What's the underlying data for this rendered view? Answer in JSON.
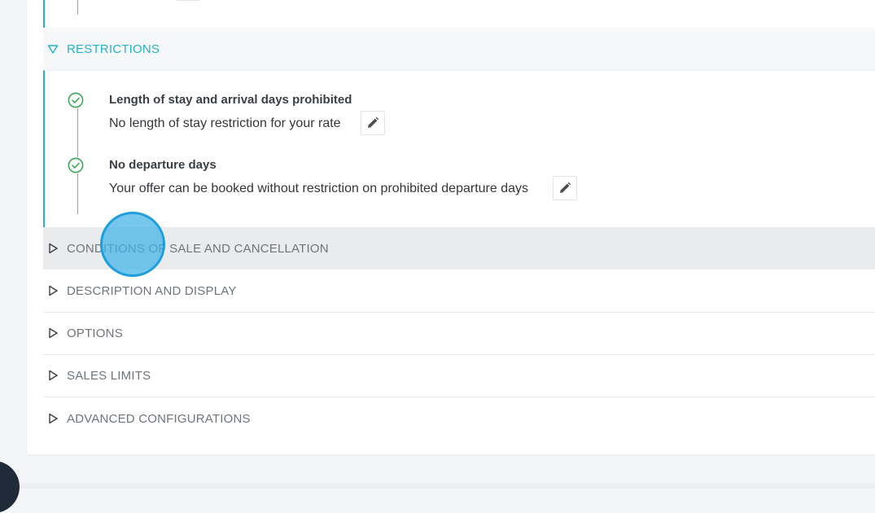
{
  "sections": {
    "restrictions": {
      "label": "RESTRICTIONS",
      "items": [
        {
          "title": "Length of stay and arrival days prohibited",
          "description": "No length of stay restriction for your rate",
          "status_icon": "check-circle-icon",
          "action_icon": "pencil-icon"
        },
        {
          "title": "No departure days",
          "description": "Your offer can be booked without restriction on prohibited departure days",
          "status_icon": "check-circle-icon",
          "action_icon": "pencil-icon"
        }
      ]
    },
    "conditions": {
      "label": "CONDITIONS OF SALE AND CANCELLATION"
    },
    "description": {
      "label": "DESCRIPTION AND DISPLAY"
    },
    "options": {
      "label": "OPTIONS"
    },
    "sales_limits": {
      "label": "SALES LIMITS"
    },
    "advanced": {
      "label": "ADVANCED CONFIGURATIONS"
    }
  },
  "colors": {
    "accent": "#24b3c8",
    "success": "#3aa657",
    "hover_row": "#e9ebed",
    "click_marker": "#40b1e6"
  }
}
